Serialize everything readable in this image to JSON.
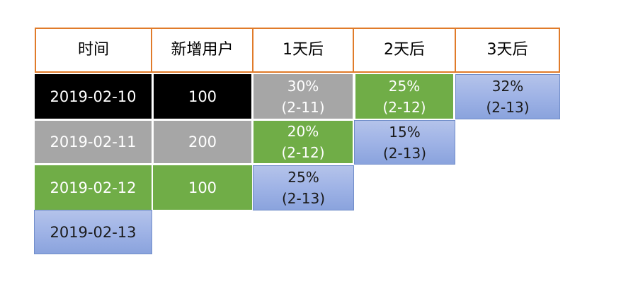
{
  "headers": [
    "时间",
    "新增用户",
    "1天后",
    "2天后",
    "3天后"
  ],
  "rows": [
    {
      "date": "2019-02-10",
      "new_users": "100",
      "retention": [
        {
          "pct": "30%",
          "day": "(2-11)"
        },
        {
          "pct": "25%",
          "day": "(2-12)"
        },
        {
          "pct": "32%",
          "day": "(2-13)"
        }
      ]
    },
    {
      "date": "2019-02-11",
      "new_users": "200",
      "retention": [
        {
          "pct": "20%",
          "day": "(2-12)"
        },
        {
          "pct": "15%",
          "day": "(2-13)"
        }
      ]
    },
    {
      "date": "2019-02-12",
      "new_users": "100",
      "retention": [
        {
          "pct": "25%",
          "day": "(2-13)"
        }
      ]
    },
    {
      "date": "2019-02-13"
    }
  ],
  "colors": {
    "header_border": "#E07B2A",
    "row_2019_02_10": "#000000",
    "row_2019_02_11": "#A6A6A6",
    "row_2019_02_12": "#70AD47",
    "row_2019_02_13": "#9FB3E6"
  }
}
